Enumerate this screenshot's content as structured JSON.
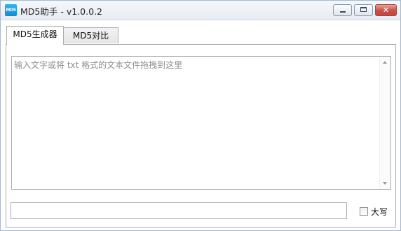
{
  "window": {
    "icon_text": "MD5",
    "title": "MD5助手 - v1.0.0.2",
    "buttons": {
      "minimize_icon": "minimize-icon",
      "maximize_icon": "maximize-icon",
      "close_icon": "close-icon",
      "close_glyph": "✕"
    }
  },
  "tabs": [
    {
      "label": "MD5生成器",
      "active": true
    },
    {
      "label": "MD5对比",
      "active": false
    }
  ],
  "generator": {
    "input_placeholder": "输入文字或将 txt 格式的文本文件拖拽到这里",
    "input_value": "",
    "output_value": "",
    "uppercase_label": "大写",
    "uppercase_checked": false
  },
  "colors": {
    "close_button": "#c75047",
    "app_icon": "#1aa0e6",
    "placeholder_text": "#8f8f8f"
  }
}
